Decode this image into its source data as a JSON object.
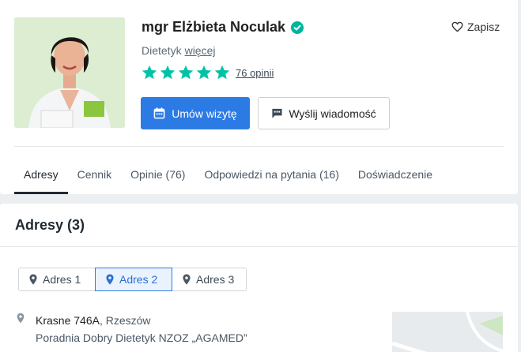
{
  "profile": {
    "name": "mgr Elżbieta Noculak",
    "specialty": "Dietetyk",
    "more_link": "więcej",
    "rating_stars": 5,
    "reviews_link": "76 opinii",
    "save_label": "Zapisz",
    "book_button": "Umów wizytę",
    "message_button": "Wyślij wiadomość"
  },
  "tabs": [
    {
      "label": "Adresy",
      "active": true
    },
    {
      "label": "Cennik",
      "active": false
    },
    {
      "label": "Opinie (76)",
      "active": false
    },
    {
      "label": "Odpowiedzi na pytania (16)",
      "active": false
    },
    {
      "label": "Doświadczenie",
      "active": false
    }
  ],
  "addresses_section": {
    "title": "Adresy (3)",
    "address_tabs": [
      {
        "label": "Adres 1",
        "active": false
      },
      {
        "label": "Adres 2",
        "active": true
      },
      {
        "label": "Adres 3",
        "active": false
      }
    ],
    "current_address": {
      "street": "Krasne 746A",
      "city": ", Rzeszów",
      "facility": "Poradnia Dobry Dietetyk NZOZ „AGAMED”"
    }
  },
  "colors": {
    "primary": "#2c7be5",
    "star": "#00c3a5",
    "verified": "#00b39b"
  },
  "icons": {
    "verified": "check-badge-icon",
    "save": "heart-icon",
    "book": "calendar-icon",
    "message": "chat-icon",
    "address": "map-pin-icon"
  }
}
